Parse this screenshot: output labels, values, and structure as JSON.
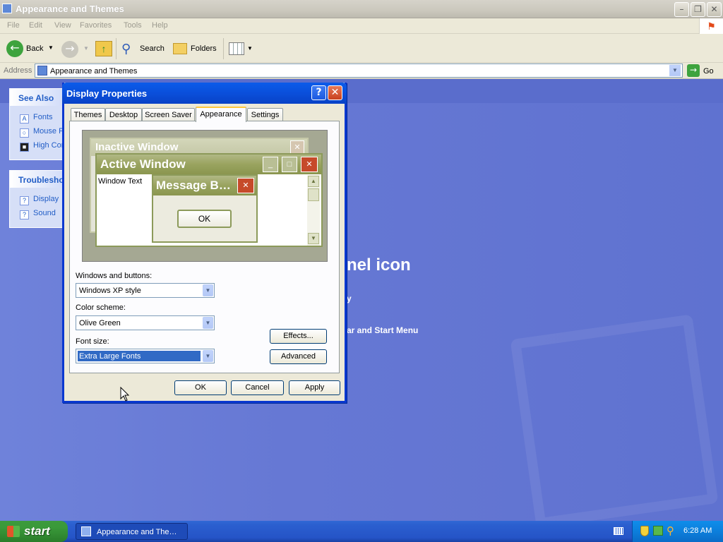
{
  "window": {
    "title": "Appearance and Themes",
    "menu": [
      "File",
      "Edit",
      "View",
      "Favorites",
      "Tools",
      "Help"
    ],
    "toolbar": {
      "back": "Back",
      "search": "Search",
      "folders": "Folders"
    },
    "address": {
      "label": "Address",
      "value": "Appearance and Themes",
      "go": "Go"
    }
  },
  "sidebar": {
    "see_also": {
      "title": "See Also",
      "items": [
        "Fonts",
        "Mouse P",
        "High Cor"
      ]
    },
    "troubleshoot": {
      "title": "Troublesho",
      "items": [
        "Display",
        "Sound"
      ]
    }
  },
  "background_text": {
    "heading": "nel icon",
    "line1": "y",
    "line2": "ar and Start Menu"
  },
  "dialog": {
    "title": "Display Properties",
    "tabs": [
      "Themes",
      "Desktop",
      "Screen Saver",
      "Appearance",
      "Settings"
    ],
    "active_tab": "Appearance",
    "preview": {
      "inactive": "Inactive Window",
      "active": "Active Window",
      "window_text": "Window Text",
      "message": "Message B…",
      "ok": "OK"
    },
    "windows_buttons_label": "Windows and buttons:",
    "windows_buttons_value": "Windows XP style",
    "color_scheme_label": "Color scheme:",
    "color_scheme_value": "Olive Green",
    "font_size_label": "Font size:",
    "font_size_value": "Extra Large Fonts",
    "effects": "Effects...",
    "advanced": "Advanced",
    "ok": "OK",
    "cancel": "Cancel",
    "apply": "Apply"
  },
  "taskbar": {
    "start": "start",
    "task": "Appearance and The…",
    "clock": "6:28 AM"
  },
  "colors": {
    "desktop_blue": "#6375d6",
    "xp_title_blue": "#0a4fdb",
    "olive": "#a5a893",
    "start_green": "#3a9a3a"
  }
}
